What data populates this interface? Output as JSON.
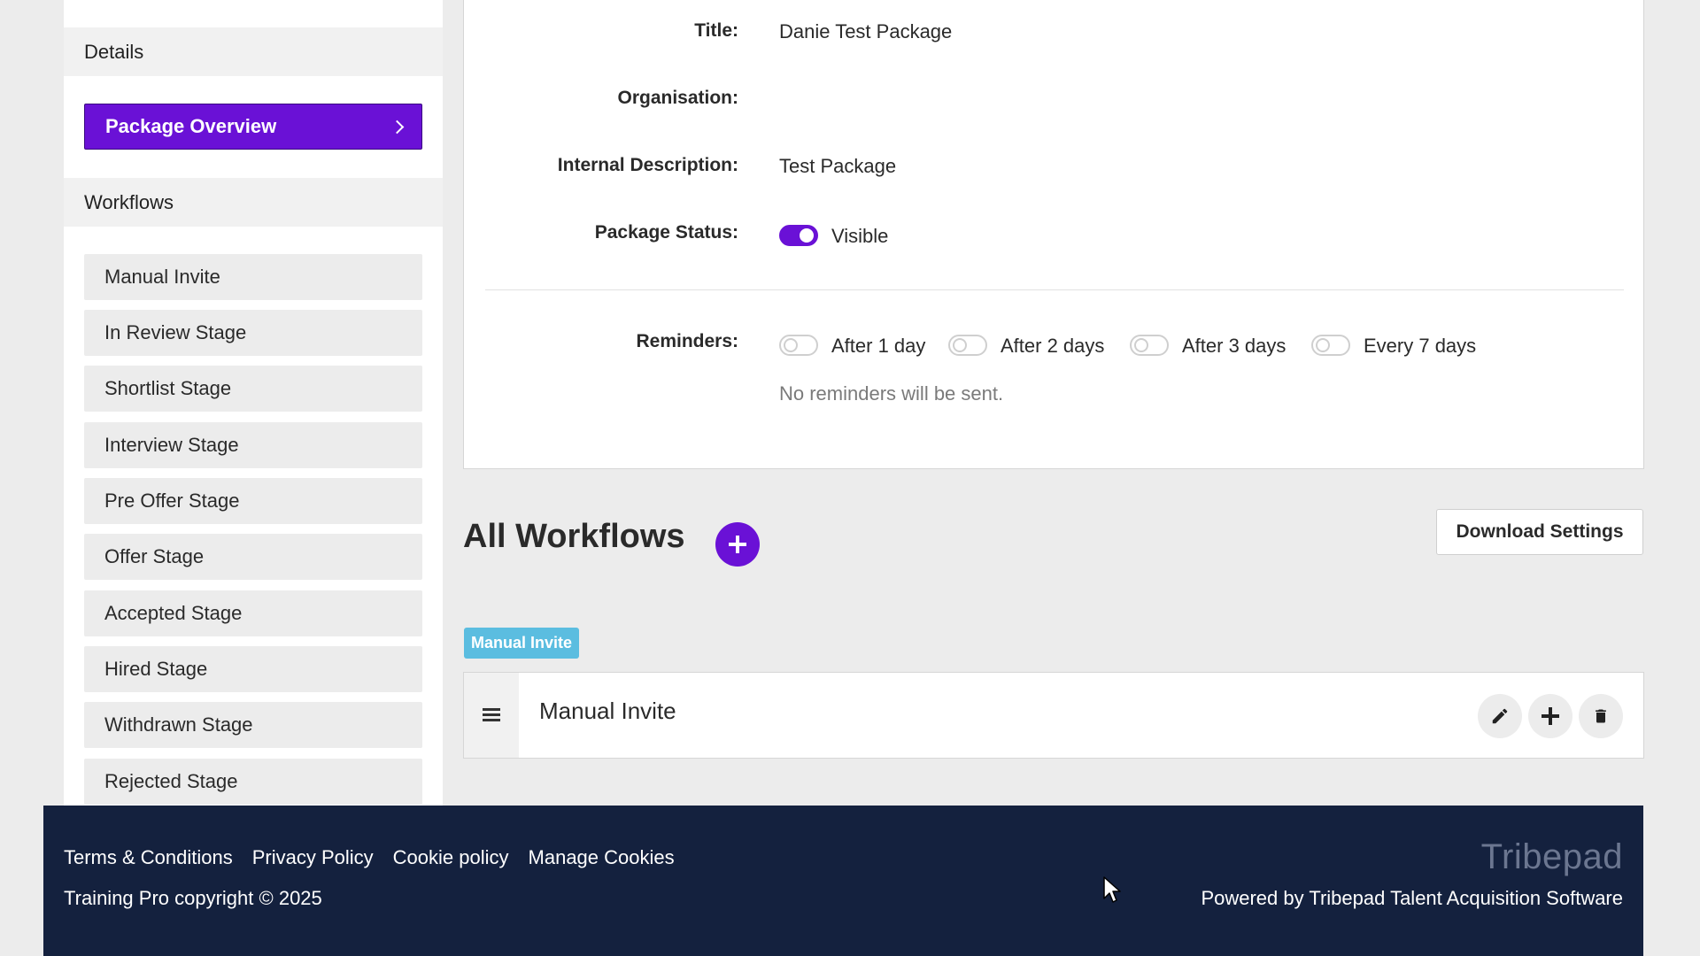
{
  "sidebar": {
    "details_header": "Details",
    "active_item": "Package Overview",
    "workflows_header": "Workflows",
    "stages": [
      "Manual Invite",
      "In Review Stage",
      "Shortlist Stage",
      "Interview Stage",
      "Pre Offer Stage",
      "Offer Stage",
      "Accepted Stage",
      "Hired Stage",
      "Withdrawn Stage",
      "Rejected Stage"
    ]
  },
  "details": {
    "title_label": "Title:",
    "title_value": "Danie Test Package",
    "organisation_label": "Organisation:",
    "organisation_value": "",
    "description_label": "Internal Description:",
    "description_value": "Test Package",
    "status_label": "Package Status:",
    "status_value": "Visible",
    "status_on": true,
    "reminders_label": "Reminders:",
    "reminders": [
      {
        "label": "After 1 day",
        "on": false
      },
      {
        "label": "After 2 days",
        "on": false
      },
      {
        "label": "After 3 days",
        "on": false
      },
      {
        "label": "Every 7 days",
        "on": false
      }
    ],
    "reminders_note": "No reminders will be sent."
  },
  "workflows": {
    "heading": "All Workflows",
    "download_label": "Download Settings",
    "tag": "Manual Invite",
    "row_title": "Manual Invite"
  },
  "footer": {
    "links": [
      "Terms & Conditions",
      "Privacy Policy",
      "Cookie policy",
      "Manage Cookies"
    ],
    "copyright": "Training Pro copyright © 2025",
    "brand": "Tribepad",
    "powered": "Powered by Tribepad Talent Acquisition Software"
  },
  "colors": {
    "accent": "#6a11d6",
    "tag": "#5bbde0",
    "footer_bg": "#14213e"
  }
}
